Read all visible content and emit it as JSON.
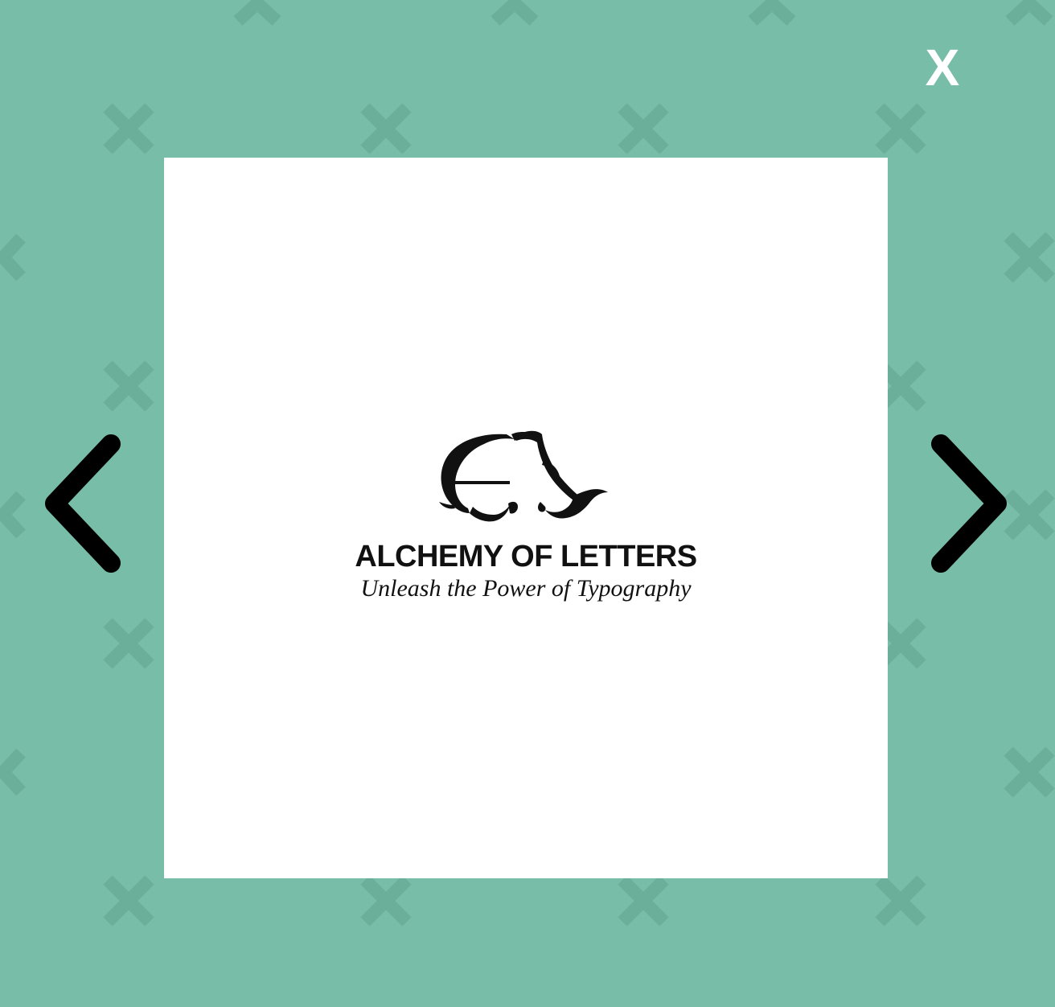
{
  "colors": {
    "background": "#78bda8",
    "pattern": "#6bae9a",
    "overlay_controls": "#ffffff",
    "nav_arrows": "#000000",
    "panel": "#ffffff",
    "logo": "#111111"
  },
  "lightbox": {
    "close_label": "X",
    "prev_icon": "chevron-left-icon",
    "next_icon": "chevron-right-icon",
    "image": {
      "logo_icon": "ornate-a-monogram",
      "brand_name": "ALCHEMY OF LETTERS",
      "tagline": "Unleash the Power of Typography"
    }
  }
}
